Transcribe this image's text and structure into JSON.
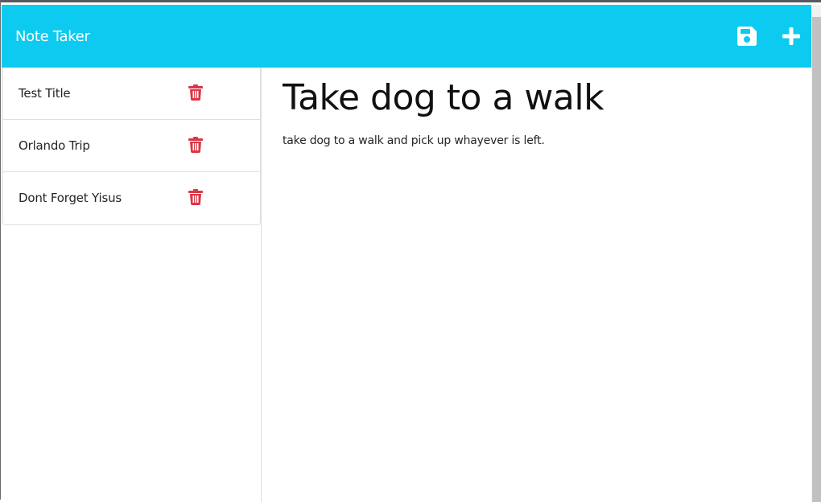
{
  "app": {
    "brand": "Note Taker"
  },
  "header": {
    "actions": [
      {
        "name": "save",
        "icon": "save-icon"
      },
      {
        "name": "new-note",
        "icon": "plus-icon"
      }
    ]
  },
  "sidebar": {
    "notes": [
      {
        "title": "Test Title",
        "icon": "trash-icon"
      },
      {
        "title": "Orlando Trip",
        "icon": "trash-icon"
      },
      {
        "title": "Dont Forget Yisus",
        "icon": "trash-icon"
      }
    ]
  },
  "editor": {
    "title": "Take dog to a walk",
    "body": "take dog to a walk and pick up whayever is left."
  },
  "colors": {
    "navbar": "#0dcaf0",
    "delete": "#dc3545",
    "text": "#212529"
  }
}
